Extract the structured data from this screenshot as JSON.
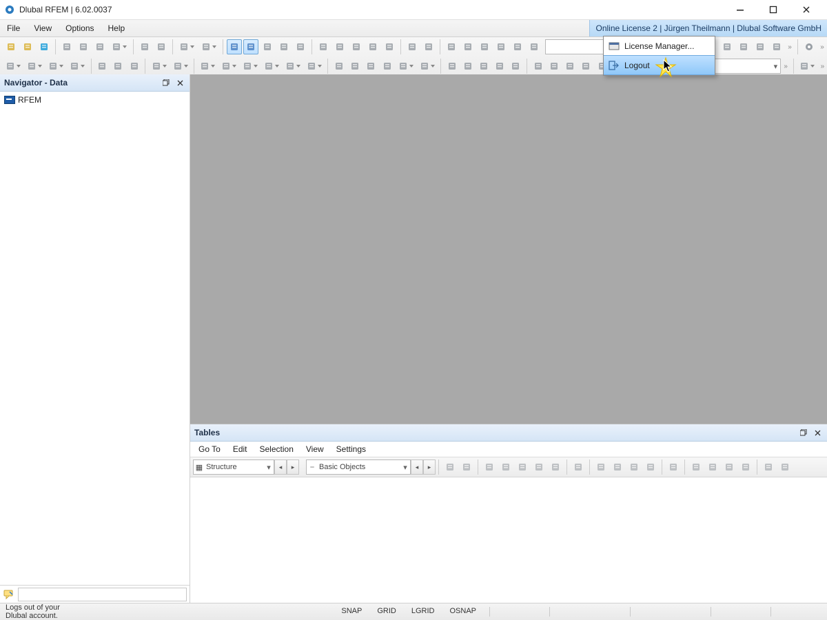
{
  "title": "Dlubal RFEM | 6.02.0037",
  "menus": {
    "file": "File",
    "view": "View",
    "options": "Options",
    "help": "Help"
  },
  "license_strip": "Online License 2 | Jürgen Theilmann | Dlubal Software GmbH",
  "toolbar_icons_row1": [
    {
      "n": "new-doc-icon",
      "c": "#d8b23b"
    },
    {
      "n": "open-icon",
      "c": "#d8b23b"
    },
    {
      "n": "cloud-icon",
      "c": "#1f9ed8"
    },
    {
      "n": "copy-icon",
      "c": "#9aa0a6"
    },
    {
      "n": "paste-icon",
      "c": "#9aa0a6"
    },
    {
      "n": "save-icon",
      "c": "#9aa0a6"
    },
    {
      "n": "print-icon",
      "c": "#9aa0a6",
      "dd": true
    },
    {
      "n": "doc1-icon",
      "c": "#9aa0a6"
    },
    {
      "n": "doc2-icon",
      "c": "#9aa0a6"
    },
    {
      "n": "undo-icon",
      "c": "#9aa0a6",
      "dd": true
    },
    {
      "n": "redo-icon",
      "c": "#9aa0a6",
      "dd": true
    },
    {
      "n": "panel-left-icon",
      "c": "#4c82c4",
      "active": true
    },
    {
      "n": "panel-grid-icon",
      "c": "#4c82c4",
      "active": true
    },
    {
      "n": "panel-right-icon",
      "c": "#9aa0a6"
    },
    {
      "n": "terminal-icon",
      "c": "#9aa0a6"
    },
    {
      "n": "script-icon",
      "c": "#9aa0a6"
    },
    {
      "n": "list-icon",
      "c": "#9aa0a6"
    },
    {
      "n": "select-rect-icon",
      "c": "#9aa0a6"
    },
    {
      "n": "select-lasso-icon",
      "c": "#9aa0a6"
    },
    {
      "n": "select-circle-icon",
      "c": "#9aa0a6"
    },
    {
      "n": "select-poly-icon",
      "c": "#9aa0a6"
    },
    {
      "n": "select-rhombus-icon",
      "c": "#9aa0a6"
    },
    {
      "n": "align-left-icon",
      "c": "#9aa0a6"
    },
    {
      "n": "align-right-icon",
      "c": "#9aa0a6"
    },
    {
      "n": "visibility-icon",
      "c": "#9aa0a6"
    },
    {
      "n": "eye-icon",
      "c": "#9aa0a6"
    },
    {
      "n": "measure-icon",
      "c": "#9aa0a6"
    },
    {
      "n": "arrow-right-icon",
      "c": "#9aa0a6"
    },
    {
      "n": "tool-target-icon",
      "c": "#9aa0a6"
    }
  ],
  "toolbar_icons_row2": [
    {
      "n": "node-icon",
      "dd": true
    },
    {
      "n": "line-icon",
      "dd": true
    },
    {
      "n": "polyline-icon",
      "dd": true
    },
    {
      "n": "member-icon",
      "dd": true
    },
    {
      "n": "surface-icon"
    },
    {
      "n": "solid-icon"
    },
    {
      "n": "opening-icon"
    },
    {
      "n": "section-icon",
      "dd": true
    },
    {
      "n": "dimension-icon",
      "dd": true
    },
    {
      "n": "support-icon",
      "dd": true
    },
    {
      "n": "hinge-icon",
      "dd": true
    },
    {
      "n": "release-icon",
      "dd": true
    },
    {
      "n": "spring-icon",
      "dd": true
    },
    {
      "n": "mass-icon",
      "dd": true
    },
    {
      "n": "loadcase-icon",
      "dd": true
    },
    {
      "n": "load-node-icon"
    },
    {
      "n": "load-line-icon"
    },
    {
      "n": "load-area-icon"
    },
    {
      "n": "load-solid-icon"
    },
    {
      "n": "load-free-icon",
      "dd": true
    },
    {
      "n": "load-wiz-icon",
      "dd": true
    },
    {
      "n": "imperf-icon"
    },
    {
      "n": "mesh-a-icon"
    },
    {
      "n": "mesh-b-icon"
    },
    {
      "n": "mesh-c-icon"
    },
    {
      "n": "mesh-d-icon"
    },
    {
      "n": "result-a-icon"
    },
    {
      "n": "result-b-icon"
    },
    {
      "n": "result-c-icon"
    },
    {
      "n": "result-d-icon"
    },
    {
      "n": "result-e-icon"
    },
    {
      "n": "result-f-icon"
    },
    {
      "n": "filter-icon",
      "dd": true
    }
  ],
  "navigator": {
    "title": "Navigator - Data",
    "root": "RFEM"
  },
  "tables": {
    "title": "Tables",
    "menus": {
      "goto": "Go To",
      "edit": "Edit",
      "selection": "Selection",
      "view": "View",
      "settings": "Settings"
    },
    "combo1": "Structure",
    "combo2": "Basic Objects"
  },
  "status": {
    "hint": "Logs out of your Dlubal account.",
    "indicators": {
      "snap": "SNAP",
      "grid": "GRID",
      "lgrid": "LGRID",
      "osnap": "OSNAP"
    }
  },
  "popup": {
    "license_manager": "License Manager...",
    "logout": "Logout"
  }
}
